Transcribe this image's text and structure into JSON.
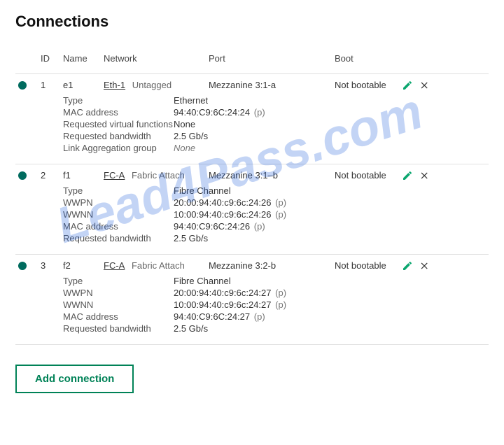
{
  "page_title": "Connections",
  "watermark": "Lead4Pass.com",
  "headers": {
    "id": "ID",
    "name": "Name",
    "network": "Network",
    "port": "Port",
    "boot": "Boot"
  },
  "detail_labels": {
    "type": "Type",
    "mac": "MAC address",
    "rvf": "Requested virtual functions",
    "bw": "Requested bandwidth",
    "lag": "Link Aggregation group",
    "wwpn": "WWPN",
    "wwnn": "WWNN"
  },
  "suffix_p": "(p)",
  "add_button": "Add connection",
  "connections": [
    {
      "id": "1",
      "name": "e1",
      "network_link": "Eth-1",
      "network_type": "Untagged",
      "port": "Mezzanine 3:1-a",
      "boot": "Not bootable",
      "details": {
        "type": "Ethernet",
        "mac": "94:40:C9:6C:24:24",
        "rvf": "None",
        "bw": "2.5 Gb/s",
        "lag": "None"
      }
    },
    {
      "id": "2",
      "name": "f1",
      "network_link": "FC-A",
      "network_type": "Fabric Attach",
      "port": "Mezzanine 3:1–b",
      "boot": "Not bootable",
      "details": {
        "type": "Fibre Channel",
        "wwpn": "20:00:94:40:c9:6c:24:26",
        "wwnn": "10:00:94:40:c9:6c:24:26",
        "mac": "94:40:C9:6C:24:26",
        "bw": "2.5 Gb/s"
      }
    },
    {
      "id": "3",
      "name": "f2",
      "network_link": "FC-A",
      "network_type": "Fabric Attach",
      "port": "Mezzanine 3:2-b",
      "boot": "Not bootable",
      "details": {
        "type": "Fibre Channel",
        "wwpn": "20:00:94:40:c9:6c:24:27",
        "wwnn": "10:00:94:40:c9:6c:24:27",
        "mac": "94:40:C9:6C:24:27",
        "bw": "2.5 Gb/s"
      }
    }
  ]
}
